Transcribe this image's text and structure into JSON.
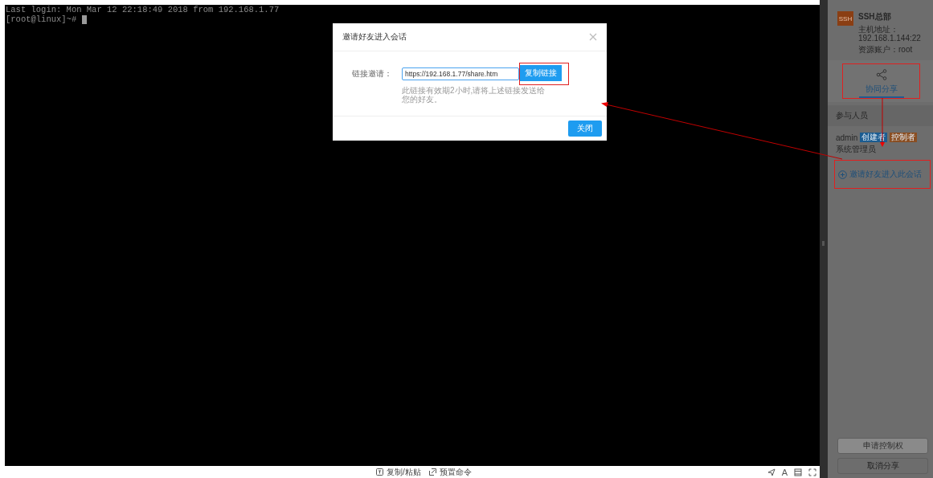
{
  "terminal": {
    "lines": [
      "Last login: Mon Mar 12 22:18:49 2018 from 192.168.1.77",
      "[root@linux]~# "
    ]
  },
  "dialog": {
    "title": "邀请好友进入会话",
    "field_label": "链接邀请：",
    "link_value": "https://192.168.1.77/share.htm",
    "copy_button": "复制链接",
    "hint": "此链接有效期2小时,请将上述链接发送给您的好友。",
    "close_button": "关闭"
  },
  "toolbar": {
    "buttons": [
      {
        "label": "复制/粘贴",
        "kind": "clipboard"
      },
      {
        "label": "预置命令",
        "kind": "command"
      }
    ],
    "font_button": "A"
  },
  "panel": {
    "badge": "SSH",
    "name": "SSH总部",
    "host": "主机地址：192.168.1.144:22",
    "account": "资源账户：root",
    "tabs": [
      {
        "label": "协同分享",
        "selected": true
      }
    ],
    "section_title": "参与人员",
    "participants": [
      {
        "name": "admin",
        "role": "系统管理员",
        "tags": [
          {
            "label": "创建者",
            "color": "#1b5c91"
          },
          {
            "label": "控制者",
            "color": "#8a4e22"
          }
        ]
      }
    ],
    "invite_button": "邀请好友进入此会话",
    "actions": [
      {
        "label": "申请控制权",
        "disabled": true
      },
      {
        "label": "取消分享",
        "disabled": false
      }
    ]
  }
}
